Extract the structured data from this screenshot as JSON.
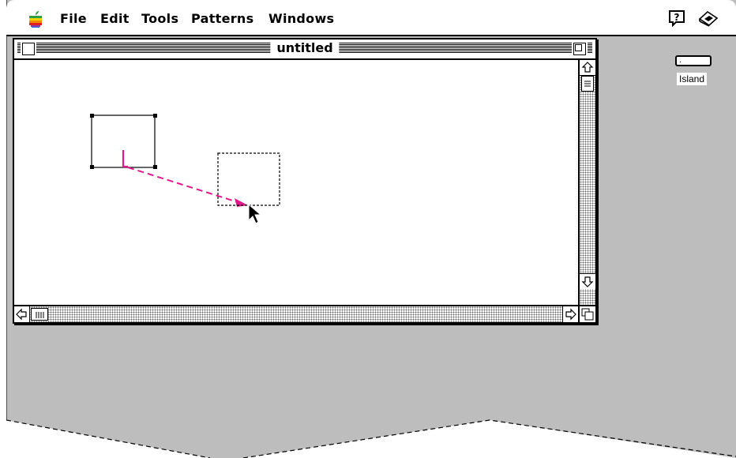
{
  "menubar": {
    "items": [
      "File",
      "Edit",
      "Tools",
      "Patterns",
      "Windows"
    ]
  },
  "icons": {
    "apple": "apple-menu-icon",
    "help": "balloon-help-icon",
    "app": "application-menu-icon"
  },
  "window": {
    "title": "untitled"
  },
  "palette": {
    "field_value": ".",
    "label": "Island"
  },
  "colors": {
    "desktop": "#bdbdbd",
    "drag_arrow": "#e0198a",
    "scroll_pattern": "#666666"
  }
}
